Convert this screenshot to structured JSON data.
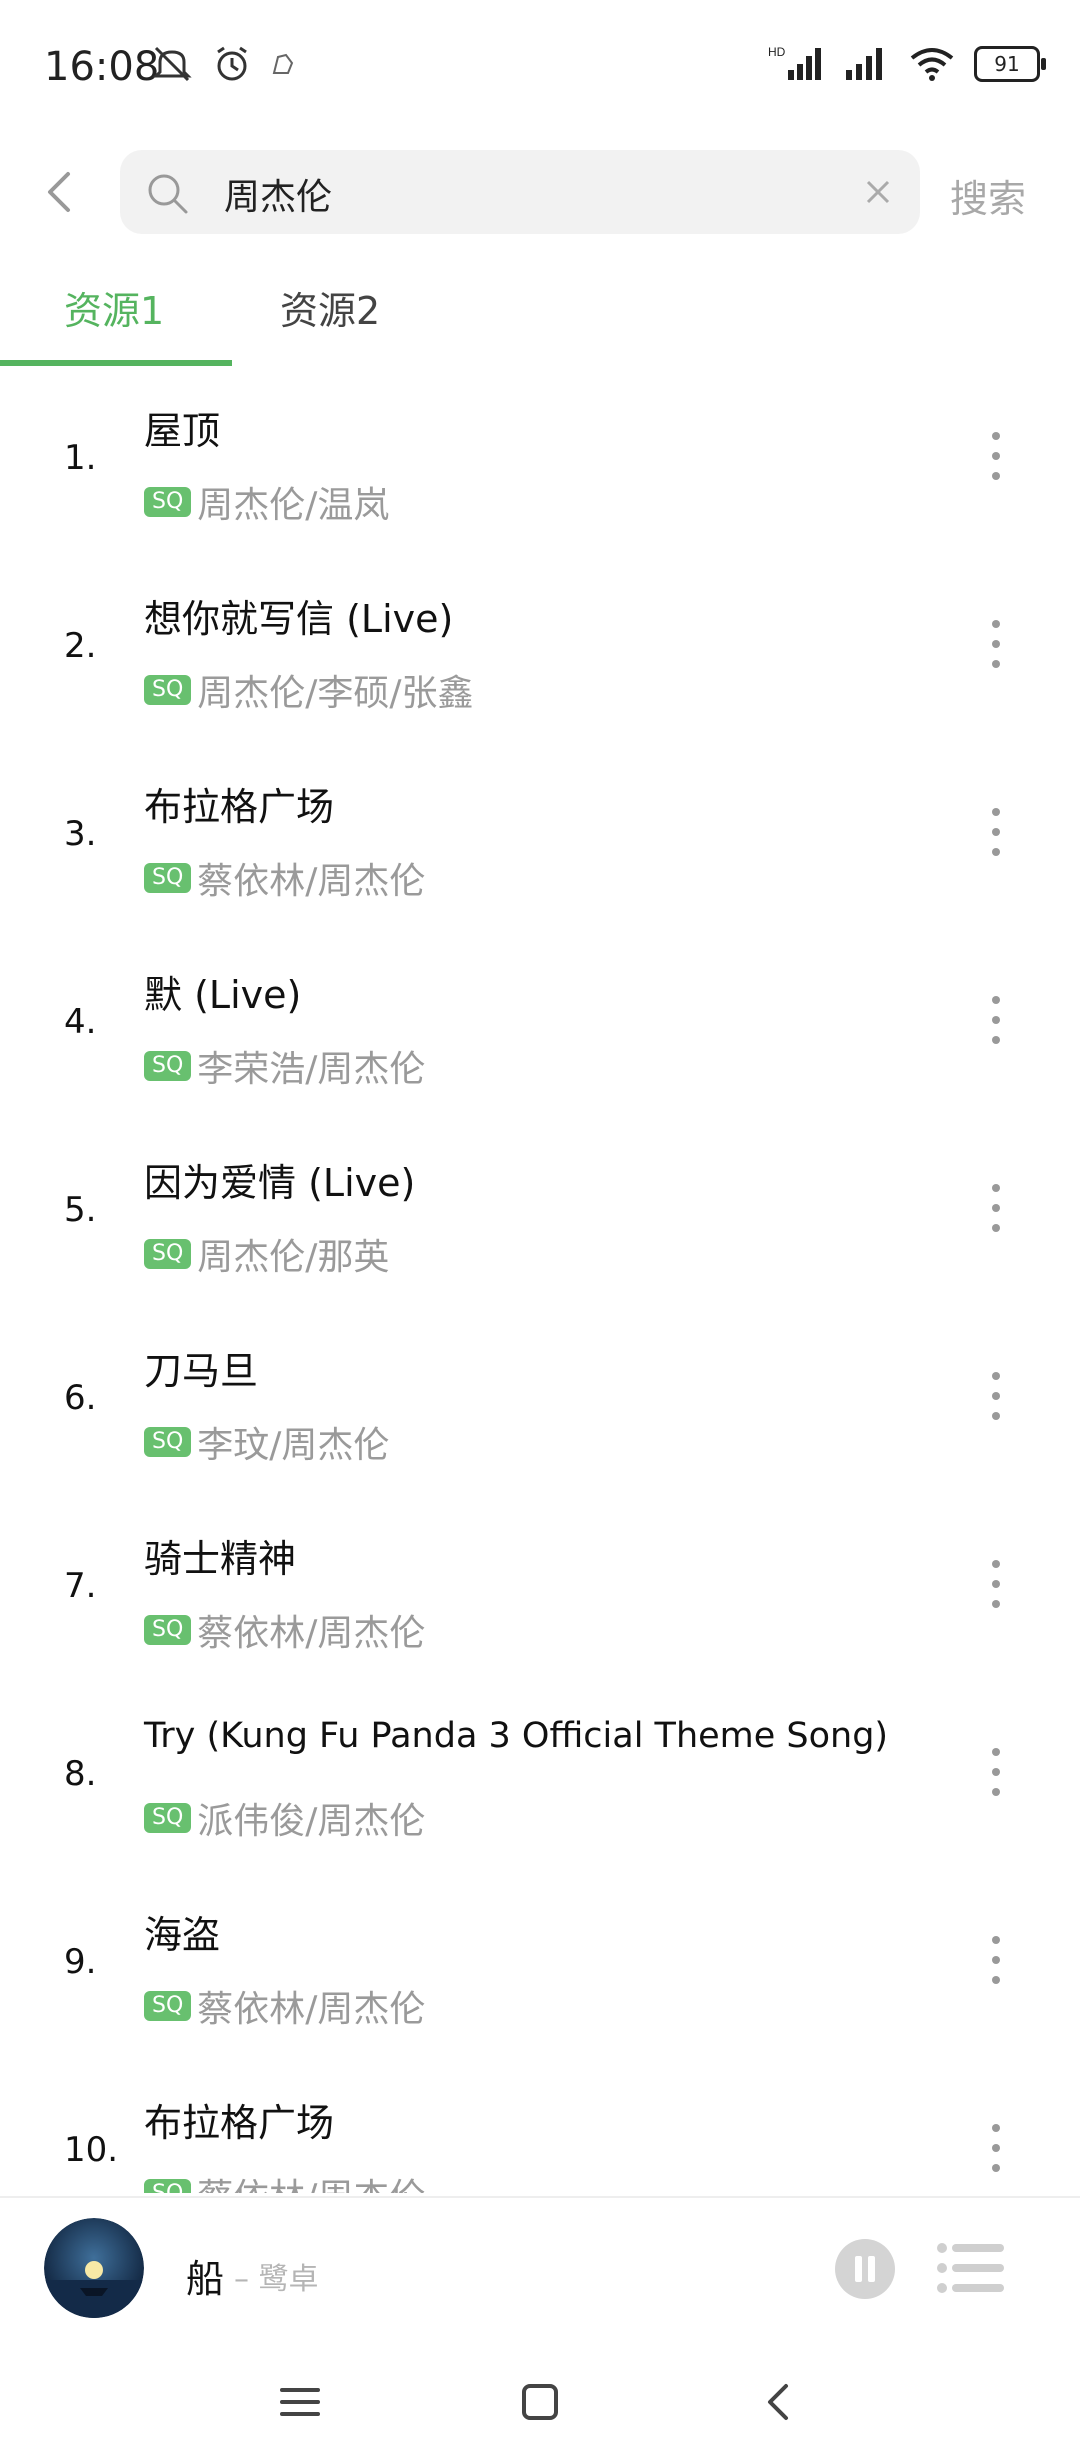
{
  "status_bar": {
    "time": "16:08",
    "battery": "91",
    "network_label": "HD"
  },
  "search": {
    "query": "周杰伦",
    "action_label": "搜索"
  },
  "tabs": [
    {
      "label": "资源1",
      "active": true
    },
    {
      "label": "资源2",
      "active": false
    }
  ],
  "results": [
    {
      "index": "1.",
      "title": "屋顶",
      "badge": "SQ",
      "artists": "周杰伦/温岚"
    },
    {
      "index": "2.",
      "title": "想你就写信 (Live)",
      "badge": "SQ",
      "artists": "周杰伦/李硕/张鑫"
    },
    {
      "index": "3.",
      "title": "布拉格广场",
      "badge": "SQ",
      "artists": "蔡依林/周杰伦"
    },
    {
      "index": "4.",
      "title": "默 (Live)",
      "badge": "SQ",
      "artists": "李荣浩/周杰伦"
    },
    {
      "index": "5.",
      "title": "因为爱情 (Live)",
      "badge": "SQ",
      "artists": "周杰伦/那英"
    },
    {
      "index": "6.",
      "title": "刀马旦",
      "badge": "SQ",
      "artists": "李玟/周杰伦"
    },
    {
      "index": "7.",
      "title": "骑士精神",
      "badge": "SQ",
      "artists": "蔡依林/周杰伦"
    },
    {
      "index": "8.",
      "title": "Try (Kung Fu Panda 3 Official Theme Song)",
      "badge": "SQ",
      "artists": "派伟俊/周杰伦"
    },
    {
      "index": "9.",
      "title": "海盗",
      "badge": "SQ",
      "artists": "蔡依林/周杰伦"
    },
    {
      "index": "10.",
      "title": "布拉格广场",
      "badge": "SQ",
      "artists": "蔡依林/周杰伦"
    }
  ],
  "player": {
    "title": "船",
    "artist": "– 鹭卓"
  },
  "colors": {
    "accent": "#55b45f",
    "badge": "#68c06f",
    "secondary_text": "#9a9a9a"
  }
}
